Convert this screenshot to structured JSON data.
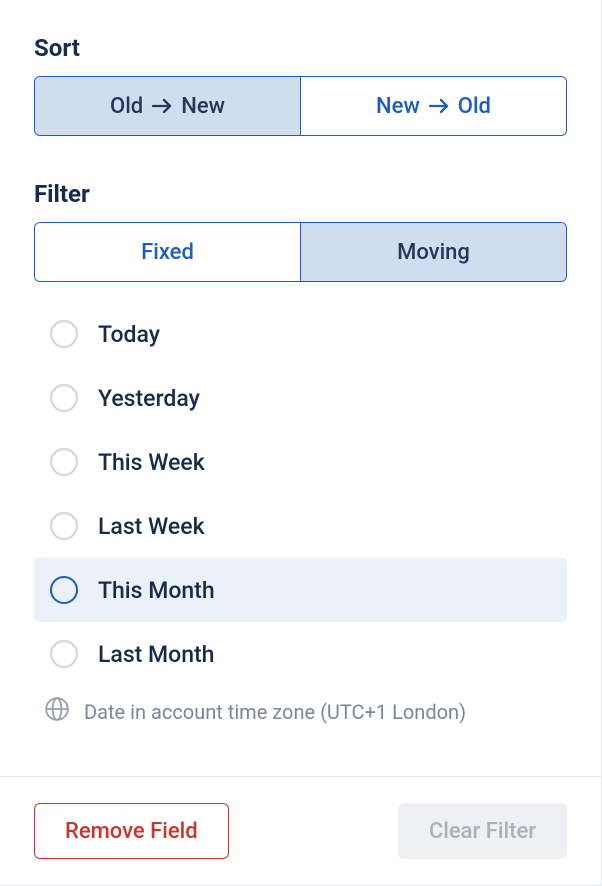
{
  "sort": {
    "label": "Sort",
    "options": [
      {
        "prefix": "Old",
        "suffix": "New",
        "selected": true
      },
      {
        "prefix": "New",
        "suffix": "Old",
        "selected": false
      }
    ]
  },
  "filter": {
    "label": "Filter",
    "tabs": [
      {
        "label": "Fixed",
        "selected": false
      },
      {
        "label": "Moving",
        "selected": true
      }
    ],
    "options": [
      {
        "label": "Today",
        "selected": false
      },
      {
        "label": "Yesterday",
        "selected": false
      },
      {
        "label": "This Week",
        "selected": false
      },
      {
        "label": "Last Week",
        "selected": false
      },
      {
        "label": "This Month",
        "selected": true
      },
      {
        "label": "Last Month",
        "selected": false
      }
    ],
    "timezone_note": "Date in account time zone (UTC+1 London)"
  },
  "footer": {
    "remove_label": "Remove Field",
    "clear_label": "Clear Filter"
  }
}
